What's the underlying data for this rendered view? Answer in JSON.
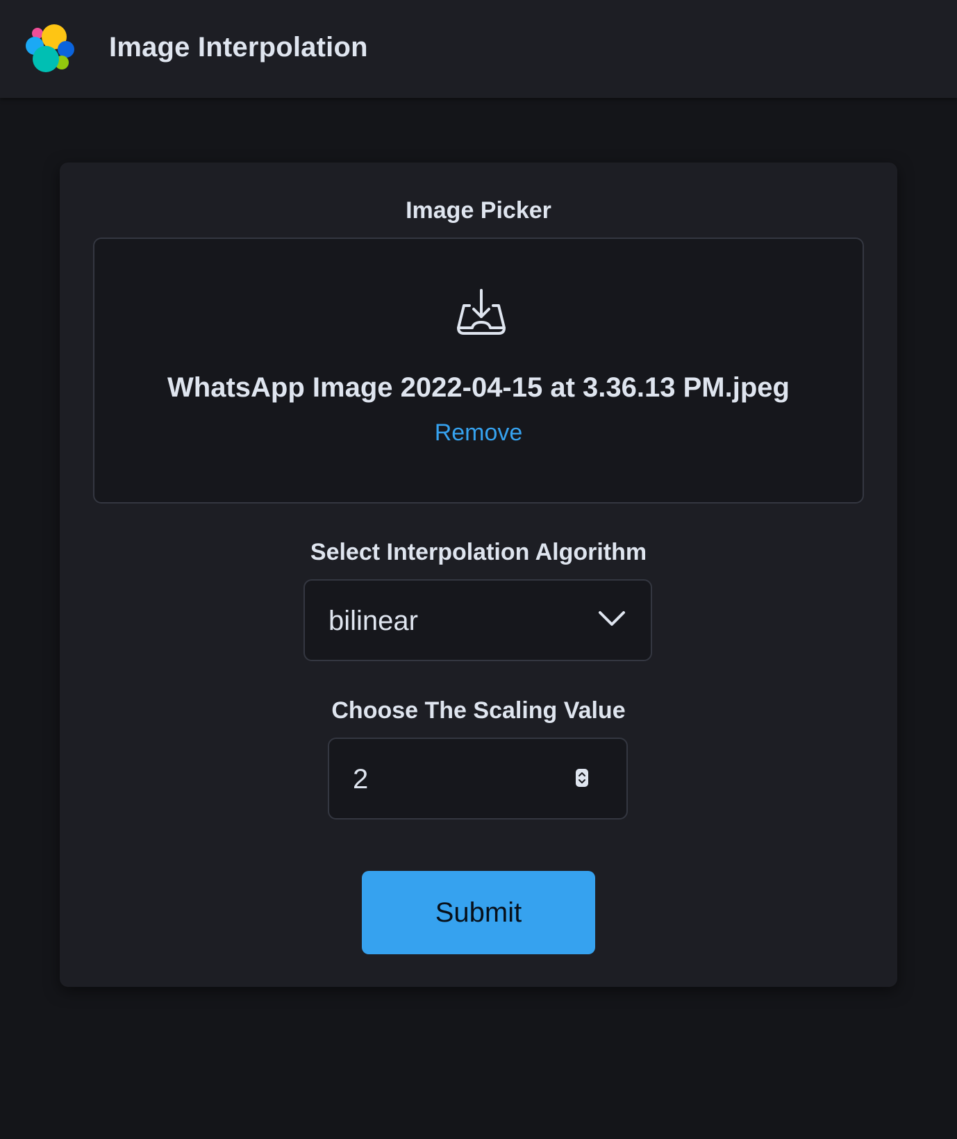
{
  "header": {
    "logo_icon": "elastic-logo-icon",
    "title": "Image Interpolation"
  },
  "image_picker": {
    "label": "Image Picker",
    "icon": "download-tray-icon",
    "file_name": "WhatsApp Image 2022-04-15 at 3.36.13 PM.jpeg",
    "remove_label": "Remove"
  },
  "algorithm": {
    "label": "Select Interpolation Algorithm",
    "selected": "bilinear",
    "icon": "chevron-down-icon"
  },
  "scaling": {
    "label": "Choose The Scaling Value",
    "value": "2",
    "icon": "stepper-arrows-icon"
  },
  "submit": {
    "label": "Submit"
  },
  "colors": {
    "page_background": "#141519",
    "panel_background": "#1d1e24",
    "field_background": "#16171c",
    "border": "#343741",
    "text": "#dfe5ef",
    "accent": "#36a2ef"
  }
}
